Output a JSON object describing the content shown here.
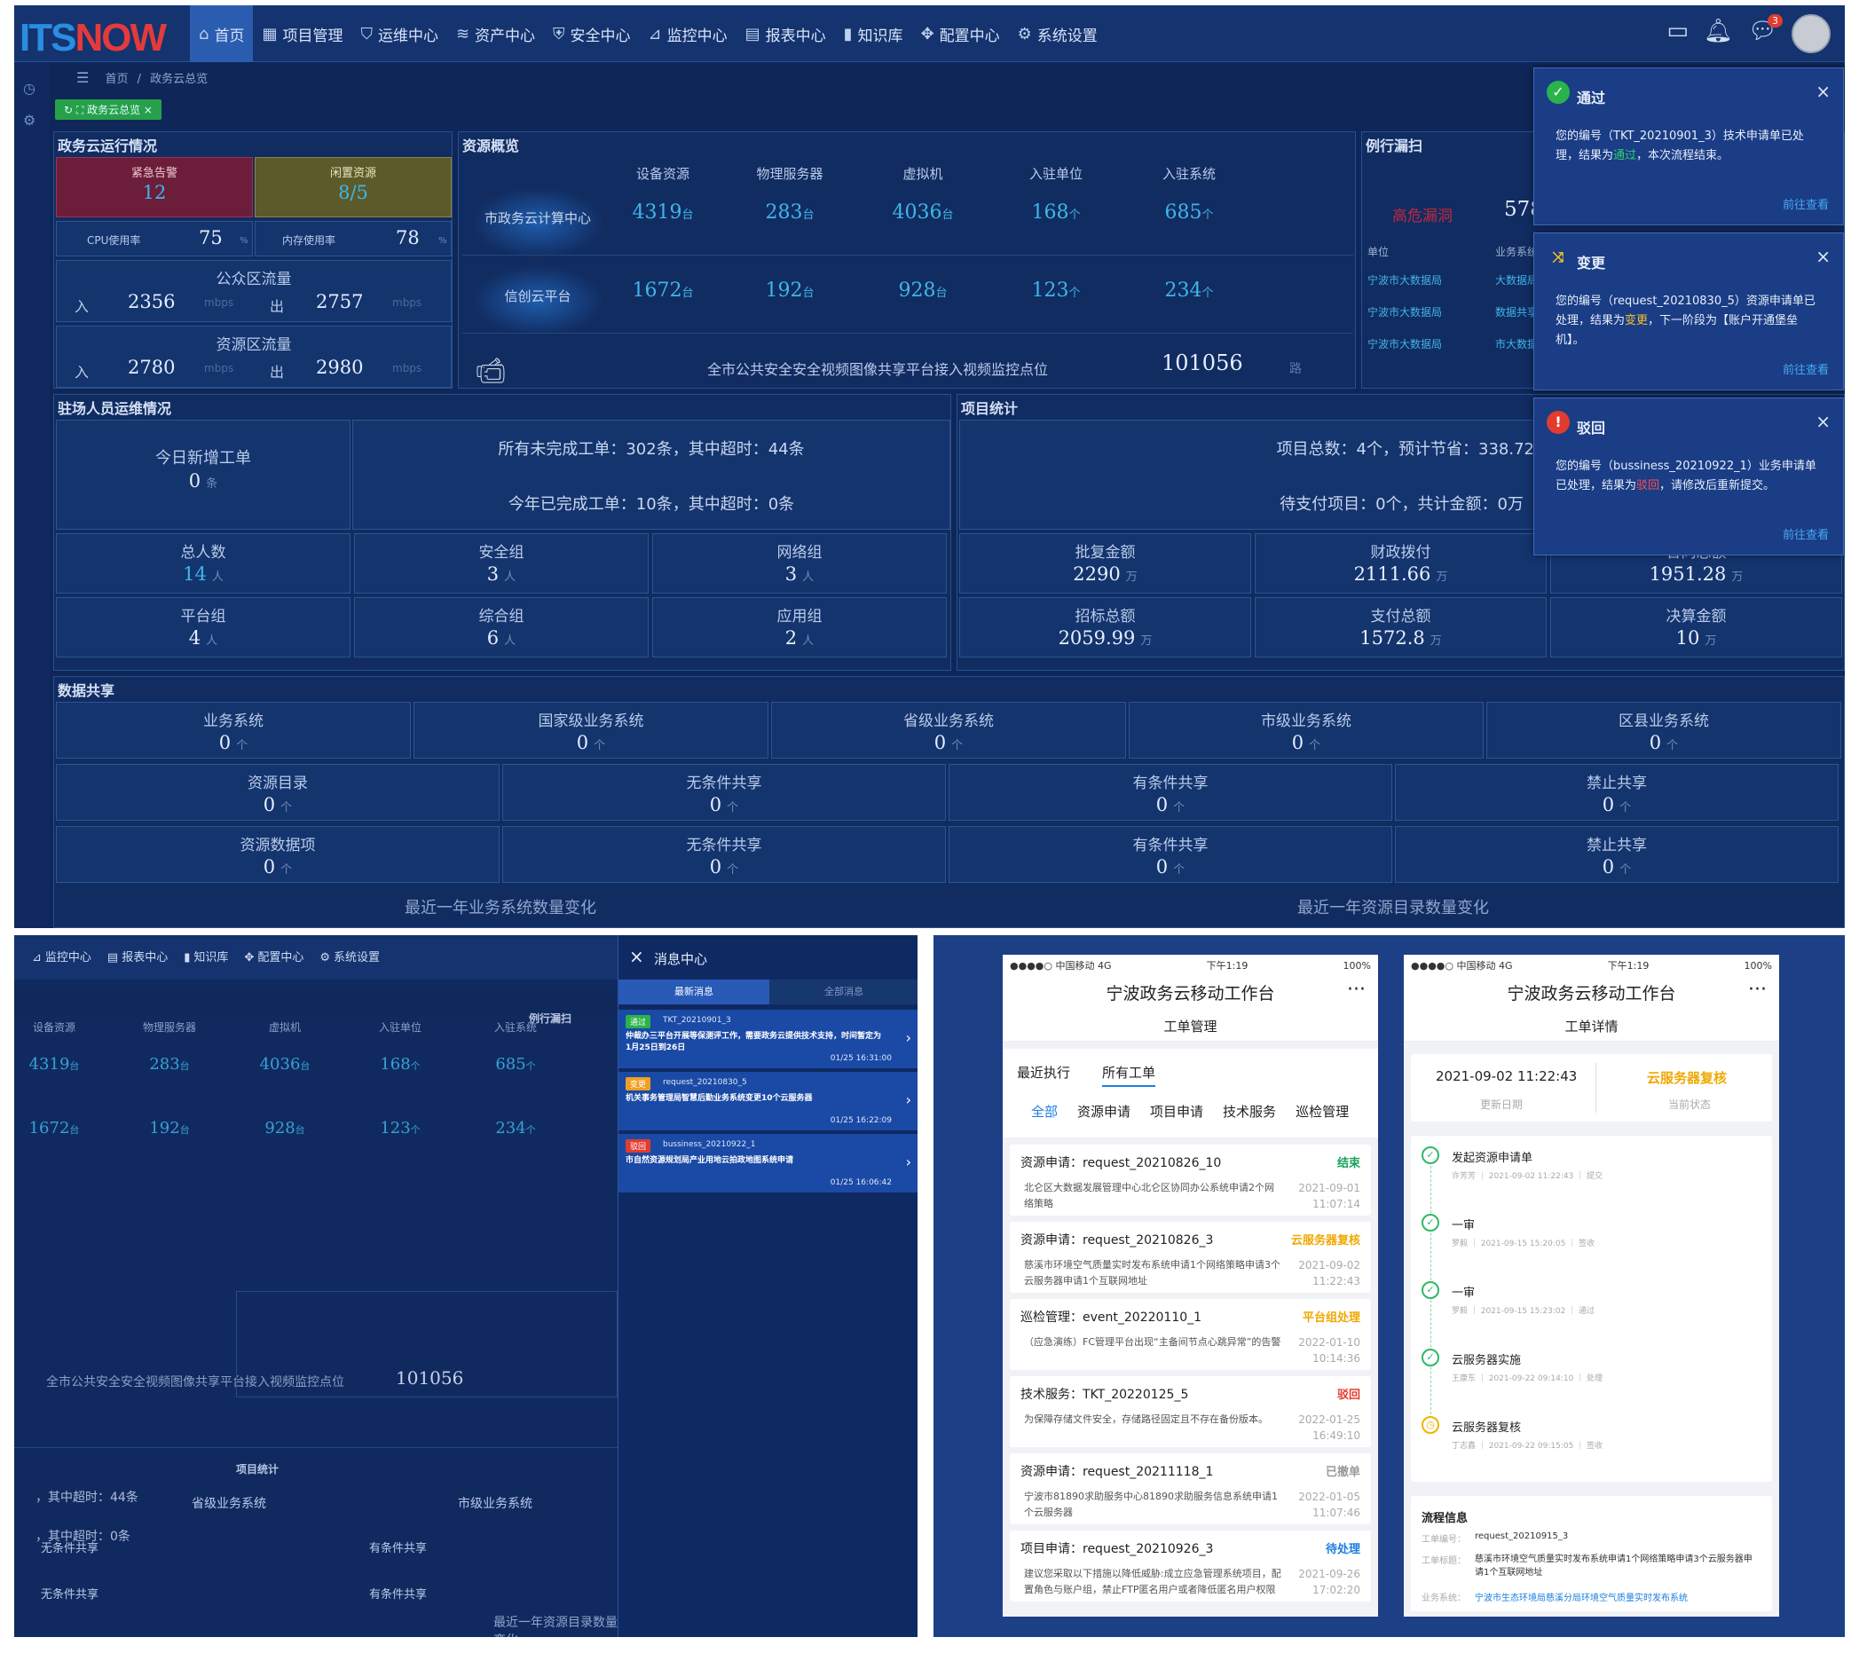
{
  "brand": {
    "left": "ITS",
    "right": "NOW"
  },
  "nav": [
    {
      "label": "首页",
      "icon": "⌂"
    },
    {
      "label": "项目管理",
      "icon": "▦"
    },
    {
      "label": "运维中心",
      "icon": "⛉"
    },
    {
      "label": "资产中心",
      "icon": "≋"
    },
    {
      "label": "安全中心",
      "icon": "⛨"
    },
    {
      "label": "监控中心",
      "icon": "⊿"
    },
    {
      "label": "报表中心",
      "icon": "▤"
    },
    {
      "label": "知识库",
      "icon": "▮"
    },
    {
      "label": "配置中心",
      "icon": "✥"
    },
    {
      "label": "系统设置",
      "icon": "⚙"
    }
  ],
  "topright": {
    "msg_badge": "3"
  },
  "breadcrumb": {
    "home": "首页",
    "sep": "/",
    "current": "政务云总览"
  },
  "tabtag": "政务云总览",
  "p1": {
    "title": "政务云运行情况",
    "alarm_label": "紧急告警",
    "alarm_value": "12",
    "idle_label": "闲置资源",
    "idle_value": "8/5",
    "cpu_label": "CPU使用率",
    "cpu_value": "75",
    "mem_label": "内存使用率",
    "mem_value": "78",
    "pct": "%",
    "public_label": "公众区流量",
    "in": "入",
    "out": "出",
    "public_in": "2356",
    "public_out": "2757",
    "unit": "mbps",
    "res_label": "资源区流量",
    "res_in": "2780",
    "res_out": "2980"
  },
  "p2": {
    "title": "资源概览",
    "cols": [
      "设备资源",
      "物理服务器",
      "虚拟机",
      "入驻单位",
      "入驻系统"
    ],
    "rows": [
      {
        "name": "市政务云计算中心",
        "vals": [
          "4319",
          "283",
          "4036",
          "168",
          "685"
        ]
      },
      {
        "name": "信创云平台",
        "vals": [
          "1672",
          "192",
          "928",
          "123",
          "234"
        ]
      }
    ],
    "units": [
      "台",
      "台",
      "台",
      "个",
      "个"
    ],
    "video_label": "全市公共安全安全视频图像共享平台接入视频监控点位",
    "video_value": "101056",
    "video_unit": "路"
  },
  "p3": {
    "title": "例行漏扫",
    "high": "高危漏洞",
    "high_value": "578",
    "hdr_unit": "单位",
    "hdr_sys": "业务系统",
    "rows": [
      {
        "unit": "宁波市大数据局",
        "sys": "大数据局"
      },
      {
        "unit": "宁波市大数据局",
        "sys": "数据共享"
      },
      {
        "unit": "宁波市大数据局",
        "sys": "市大数据"
      }
    ]
  },
  "p4": {
    "title": "驻场人员运维情况",
    "today_label": "今日新增工单",
    "today_value": "0",
    "tiao": "条",
    "open_text": "所有未完成工单：302条，其中超时：44条",
    "done_text": "今年已完成工单：10条，其中超时：0条",
    "grid": [
      {
        "label": "总人数",
        "value": "14"
      },
      {
        "label": "安全组",
        "value": "3"
      },
      {
        "label": "网络组",
        "value": "3"
      },
      {
        "label": "平台组",
        "value": "4"
      },
      {
        "label": "综合组",
        "value": "6"
      },
      {
        "label": "应用组",
        "value": "2"
      }
    ],
    "ren": "人"
  },
  "p5": {
    "title": "项目统计",
    "line1": "项目总数：4个，预计节省：338.72万",
    "line2": "待支付项目：0个，共计金额：0万",
    "grid": [
      {
        "label": "批复金额",
        "value": "2290"
      },
      {
        "label": "财政拨付",
        "value": "2111.66"
      },
      {
        "label": "合同总额",
        "value": "1951.28"
      },
      {
        "label": "招标总额",
        "value": "2059.99"
      },
      {
        "label": "支付总额",
        "value": "1572.8"
      },
      {
        "label": "决算金额",
        "value": "10"
      }
    ],
    "wan": "万"
  },
  "p6": {
    "title": "数据共享",
    "row1": [
      {
        "label": "业务系统",
        "value": "0"
      },
      {
        "label": "国家级业务系统",
        "value": "0"
      },
      {
        "label": "省级业务系统",
        "value": "0"
      },
      {
        "label": "市级业务系统",
        "value": "0"
      },
      {
        "label": "区县业务系统",
        "value": "0"
      }
    ],
    "row2": [
      {
        "label": "资源目录",
        "value": "0"
      },
      {
        "label": "无条件共享",
        "value": "0"
      },
      {
        "label": "有条件共享",
        "value": "0"
      },
      {
        "label": "禁止共享",
        "value": "0"
      }
    ],
    "row3": [
      {
        "label": "资源数据项",
        "value": "0"
      },
      {
        "label": "无条件共享",
        "value": "0"
      },
      {
        "label": "有条件共享",
        "value": "0"
      },
      {
        "label": "禁止共享",
        "value": "0"
      }
    ],
    "ge": "个",
    "chart1": "最近一年业务系统数量变化",
    "chart2": "最近一年资源目录数量变化"
  },
  "toasts": [
    {
      "title": "通过",
      "body_pre": "您的编号（TKT_20210901_3）技术申请单已处理，结果为",
      "body_hl": "通过",
      "body_post": "，本次流程结束。",
      "link": "前往查看",
      "color": "#2fd06a",
      "icon": "✓",
      "iconbg": "#2ab34a"
    },
    {
      "title": "变更",
      "body_pre": "您的编号（request_20210830_5）资源申请单已处理，结果为",
      "body_hl": "变更",
      "body_post": "，下一阶段为【账户开通堡垒机】。",
      "link": "前往查看",
      "color": "#f7c22b",
      "icon": "⤨",
      "iconbg": "transparent"
    },
    {
      "title": "驳回",
      "body_pre": "您的编号（bussiness_20210922_1）业务申请单已处理，结果为",
      "body_hl": "驳回",
      "body_post": "，请修改后重新提交。",
      "link": "前往查看",
      "color": "#ff4d4f",
      "icon": "!",
      "iconbg": "#e23c2e"
    }
  ],
  "msgcenter": {
    "title": "消息中心",
    "tab1": "最新消息",
    "tab2": "全部消息",
    "items": [
      {
        "tag": "通过",
        "tagcolor": "#2ab34a",
        "id": "TKT_20210901_3",
        "text": "仲裁办三平台开展等保测评工作，需要政务云提供技术支持，时间暂定为1月25日到26日",
        "time": "01/25 16:31:00"
      },
      {
        "tag": "变更",
        "tagcolor": "#f0a020",
        "id": "request_20210830_5",
        "text": "机关事务管理局智慧后勤业务系统变更10个云服务器",
        "time": "01/25 16:22:09"
      },
      {
        "tag": "驳回",
        "tagcolor": "#e23c2e",
        "id": "bussiness_20210922_1",
        "text": "市自然资源规划局产业用地云拍政地图系统申请",
        "time": "01/25 16:06:42"
      }
    ]
  },
  "phone1": {
    "carrier": "●●●●○ 中国移动 4G",
    "time": "下午1:19",
    "battery": "100%",
    "title": "宁波政务云移动工作台",
    "sub": "工单管理",
    "tabs": [
      "最近执行",
      "所有工单"
    ],
    "filters": [
      "全部",
      "资源申请",
      "项目申请",
      "技术服务",
      "巡检管理"
    ],
    "orders": [
      {
        "title": "资源申请：request_20210826_10",
        "status": "结束",
        "color": "#18a05a",
        "desc": "北仑区大数据发展管理中心北仑区协同办公系统申请2个网络策略",
        "date": "2021-09-01",
        "time": "11:07:14"
      },
      {
        "title": "资源申请：request_20210826_3",
        "status": "云服务器复核",
        "color": "#f0a800",
        "desc": "慈溪市环境空气质量实时发布系统申请1个网络策略申请3个云服务器申请1个互联网地址",
        "date": "2021-09-02",
        "time": "11:22:43"
      },
      {
        "title": "巡检管理：event_20220110_1",
        "status": "平台组处理",
        "color": "#f0a800",
        "desc": "（应急演练）FC管理平台出现“主备间节点心跳异常”的告警",
        "date": "2022-01-10",
        "time": "10:14:36"
      },
      {
        "title": "技术服务：TKT_20220125_5",
        "status": "驳回",
        "color": "#e23c2e",
        "desc": "为保障存储文件安全，存储路径固定且不存在备份版本。",
        "date": "2022-01-25",
        "time": "16:49:10"
      },
      {
        "title": "资源申请：request_20211118_1",
        "status": "已撤单",
        "color": "#999999",
        "desc": "宁波市81890求助服务中心81890求助服务信息系统申请1个云服务器",
        "date": "2022-01-05",
        "time": "11:07:46"
      },
      {
        "title": "项目申请：request_20210926_3",
        "status": "待处理",
        "color": "#1a7fe0",
        "desc": "建议您采取以下措施以降低威胁:成立应急管理系统项目，配置角色与账户组，禁止FTP匿名用户或者降低匿名用户权限",
        "date": "2021-09-26",
        "time": "17:02:20"
      }
    ]
  },
  "phone2": {
    "carrier": "●●●●○ 中国移动 4G",
    "time": "下午1:19",
    "battery": "100%",
    "title": "宁波政务云移动工作台",
    "sub": "工单详情",
    "update_value": "2021-09-02 11:22:43",
    "update_label": "更新日期",
    "state_value": "云服务器复核",
    "state_label": "当前状态",
    "steps": [
      {
        "name": "发起资源申请单",
        "meta": "许芳芳 ｜ 2021-09-02 11:22:43 ｜ 提交",
        "done": true
      },
      {
        "name": "一审",
        "meta": "罗毅 ｜ 2021-09-15 15:20:05 ｜ 签收",
        "done": true
      },
      {
        "name": "一审",
        "meta": "罗毅 ｜ 2021-09-15 15:23:02 ｜ 通过",
        "done": true
      },
      {
        "name": "云服务器实施",
        "meta": "王康东 ｜ 2021-09-22 09:14:10 ｜ 处理",
        "done": true
      },
      {
        "name": "云服务器复核",
        "meta": "丁志鑫 ｜ 2021-09-22 09:15:05 ｜ 签收",
        "done": false
      }
    ],
    "flow_title": "流程信息",
    "f1_label": "工单编号：",
    "f1_value": "request_20210915_3",
    "f2_label": "工单标题：",
    "f2_value": "慈溪市环境空气质量实时发布系统申请1个网络策略申请3个云服务器申请1个互联网地址",
    "f3_label": "业务系统：",
    "f3_value": "宁波市生态环境局慈溪分局环境空气质量实时发布系统"
  }
}
